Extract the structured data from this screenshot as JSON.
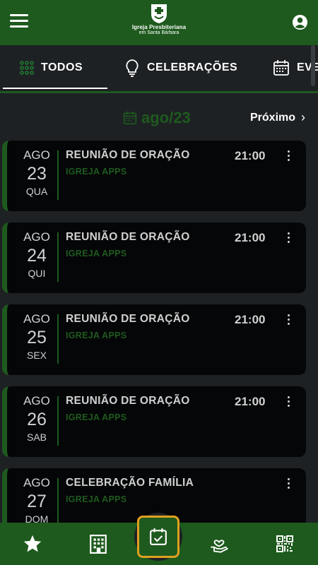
{
  "header": {
    "menu_icon": "hamburger-icon",
    "logo_line1": "Igreja Presbiteriana",
    "logo_line2": "em Santa Bárbara",
    "user_icon": "account-circle-icon"
  },
  "tabs": [
    {
      "label": "TODOS",
      "icon": "grid-dots-icon",
      "active": true
    },
    {
      "label": "CELEBRAÇÕES",
      "icon": "lightbulb-icon",
      "active": false
    },
    {
      "label": "EVENTOS",
      "icon": "calendar-icon",
      "active": false
    }
  ],
  "month_nav": {
    "month": "ago/23",
    "next_label": "Próximo",
    "next_icon": "chevron-right-icon"
  },
  "events": [
    {
      "month": "AGO",
      "day": "23",
      "weekday": "QUA",
      "title": "REUNIÃO DE ORAÇÃO",
      "subtitle": "IGREJA APPS",
      "time": "21:00"
    },
    {
      "month": "AGO",
      "day": "24",
      "weekday": "QUI",
      "title": "REUNIÃO DE ORAÇÃO",
      "subtitle": "IGREJA APPS",
      "time": "21:00"
    },
    {
      "month": "AGO",
      "day": "25",
      "weekday": "SEX",
      "title": "REUNIÃO DE ORAÇÃO",
      "subtitle": "IGREJA APPS",
      "time": "21:00"
    },
    {
      "month": "AGO",
      "day": "26",
      "weekday": "SAB",
      "title": "REUNIÃO DE ORAÇÃO",
      "subtitle": "IGREJA APPS",
      "time": "21:00"
    },
    {
      "month": "AGO",
      "day": "27",
      "weekday": "DOM",
      "title": "CELEBRAÇÃO FAMÍLIA",
      "subtitle": "IGREJA APPS",
      "time": ""
    }
  ],
  "bottom_nav": [
    {
      "icon": "star-icon"
    },
    {
      "icon": "building-icon"
    },
    {
      "icon": "calendar-check-icon",
      "active": true
    },
    {
      "icon": "hand-heart-icon"
    },
    {
      "icon": "qr-code-icon"
    }
  ],
  "colors": {
    "brand_green": "#1e5a1e",
    "background": "#1e2124",
    "card": "#050607",
    "active_outline": "#e0a020"
  }
}
